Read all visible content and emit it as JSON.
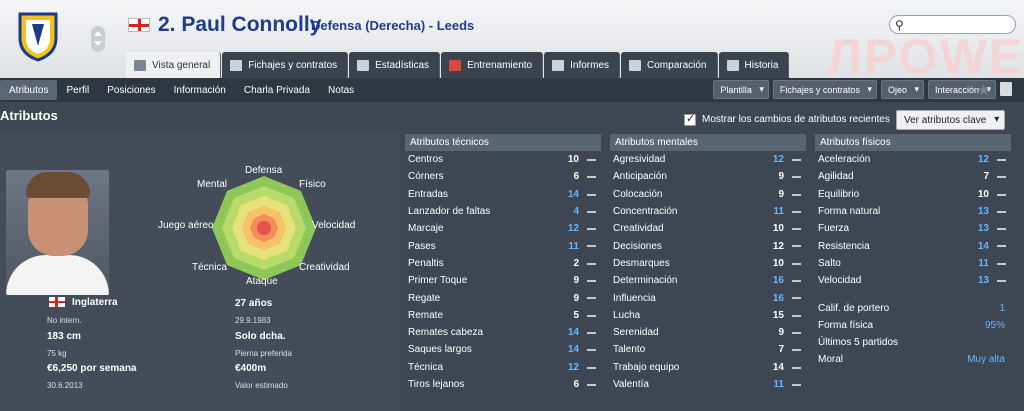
{
  "header": {
    "watermark": "ЛРОWE",
    "player_title": "2. Paul Connolly",
    "player_subtitle": "Defensa (Derecha) - Leeds"
  },
  "tabs": [
    {
      "label": "Vista general",
      "icon": "overview-icon"
    },
    {
      "label": "Fichajes y contratos",
      "icon": "contract-icon"
    },
    {
      "label": "Estadísticas",
      "icon": "stats-icon"
    },
    {
      "label": "Entrenamiento",
      "icon": "training-icon"
    },
    {
      "label": "Informes",
      "icon": "report-icon"
    },
    {
      "label": "Comparación",
      "icon": "compare-icon"
    },
    {
      "label": "Historia",
      "icon": "history-icon"
    }
  ],
  "subnav": [
    "Atributos",
    "Perfil",
    "Posiciones",
    "Información",
    "Charla Privada",
    "Notas"
  ],
  "dropdowns": [
    "Plantilla",
    "Fichajes y contratos",
    "Ojeo",
    "Interacción"
  ],
  "section": {
    "title": "Atributos",
    "recent_changes_label": "Mostrar los cambios de atributos recientes",
    "key_attributes_button": "Ver atributos clave"
  },
  "radar_labels": [
    "Defensa",
    "Físico",
    "Velocidad",
    "Creatividad",
    "Ataque",
    "Técnica",
    "Juego aéreo",
    "Mental"
  ],
  "player_info": {
    "nationality": "Inglaterra",
    "intl_status": "No intern.",
    "height": "183 cm",
    "weight": "75 kg",
    "wage": "€6,250 por semana",
    "contract_end": "30.6.2013",
    "age": "27 años",
    "dob": "29.9.1983",
    "foot": "Solo dcha.",
    "foot_label": "Pierna preferida",
    "value": "€400m",
    "value_label": "Valor estimado"
  },
  "technical": {
    "title": "Atributos técnicos",
    "rows": [
      {
        "name": "Centros",
        "value": "10",
        "blue": false
      },
      {
        "name": "Córners",
        "value": "6",
        "blue": false
      },
      {
        "name": "Entradas",
        "value": "14",
        "blue": true
      },
      {
        "name": "Lanzador de faltas",
        "value": "4",
        "blue": true
      },
      {
        "name": "Marcaje",
        "value": "12",
        "blue": true
      },
      {
        "name": "Pases",
        "value": "11",
        "blue": true
      },
      {
        "name": "Penaltis",
        "value": "2",
        "blue": false
      },
      {
        "name": "Primer Toque",
        "value": "9",
        "blue": false
      },
      {
        "name": "Regate",
        "value": "9",
        "blue": false
      },
      {
        "name": "Remate",
        "value": "5",
        "blue": false
      },
      {
        "name": "Remates cabeza",
        "value": "14",
        "blue": true
      },
      {
        "name": "Saques largos",
        "value": "14",
        "blue": true
      },
      {
        "name": "Técnica",
        "value": "12",
        "blue": true
      },
      {
        "name": "Tiros lejanos",
        "value": "6",
        "blue": false
      }
    ]
  },
  "mental": {
    "title": "Atributos mentales",
    "rows": [
      {
        "name": "Agresividad",
        "value": "12",
        "blue": true
      },
      {
        "name": "Anticipación",
        "value": "9",
        "blue": false
      },
      {
        "name": "Colocación",
        "value": "9",
        "blue": false
      },
      {
        "name": "Concentración",
        "value": "11",
        "blue": true
      },
      {
        "name": "Creatividad",
        "value": "10",
        "blue": false
      },
      {
        "name": "Decisiones",
        "value": "12",
        "blue": false
      },
      {
        "name": "Desmarques",
        "value": "10",
        "blue": false
      },
      {
        "name": "Determinación",
        "value": "16",
        "blue": true
      },
      {
        "name": "Influencia",
        "value": "16",
        "blue": true
      },
      {
        "name": "Lucha",
        "value": "15",
        "blue": false
      },
      {
        "name": "Serenidad",
        "value": "9",
        "blue": false
      },
      {
        "name": "Talento",
        "value": "7",
        "blue": false
      },
      {
        "name": "Trabajo equipo",
        "value": "14",
        "blue": false
      },
      {
        "name": "Valentía",
        "value": "11",
        "blue": true
      }
    ]
  },
  "physical": {
    "title": "Atributos físicos",
    "rows": [
      {
        "name": "Aceleración",
        "value": "12",
        "blue": true
      },
      {
        "name": "Agilidad",
        "value": "7",
        "blue": false
      },
      {
        "name": "Equilibrio",
        "value": "10",
        "blue": false
      },
      {
        "name": "Forma natural",
        "value": "13",
        "blue": true
      },
      {
        "name": "Fuerza",
        "value": "13",
        "blue": true
      },
      {
        "name": "Resistencia",
        "value": "14",
        "blue": true
      },
      {
        "name": "Salto",
        "value": "11",
        "blue": true
      },
      {
        "name": "Velocidad",
        "value": "13",
        "blue": true
      }
    ],
    "extra": [
      {
        "name": "Calif. de portero",
        "value": "1"
      },
      {
        "name": "Forma física",
        "value": "95%"
      },
      {
        "name": "Últimos 5 partidos",
        "value": ""
      },
      {
        "name": "Moral",
        "value": "Muy alta"
      }
    ]
  }
}
